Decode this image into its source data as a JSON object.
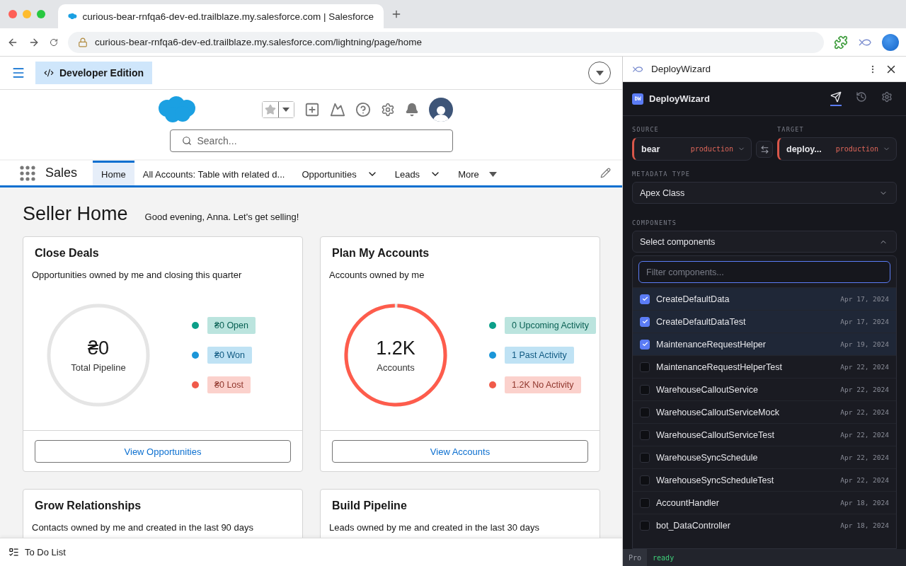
{
  "browser": {
    "tab_title": "curious-bear-rnfqa6-dev-ed.trailblaze.my.salesforce.com | Salesforce",
    "url": "curious-bear-rnfqa6-dev-ed.trailblaze.my.salesforce.com/lightning/page/home"
  },
  "salesforce": {
    "edition": "Developer Edition",
    "search_placeholder": "Search...",
    "app_name": "Sales",
    "nav": [
      {
        "label": "Home",
        "selected": true,
        "kind": "tab"
      },
      {
        "label": "All Accounts: Table with related d...",
        "selected": false,
        "kind": "tab"
      },
      {
        "label": "Opportunities",
        "selected": false,
        "kind": "menu"
      },
      {
        "label": "Leads",
        "selected": false,
        "kind": "menu"
      },
      {
        "label": "More",
        "selected": false,
        "kind": "more"
      }
    ],
    "page_title": "Seller Home",
    "greeting": "Good evening, Anna. Let's get selling!",
    "cards": [
      {
        "title": "Close Deals",
        "subtitle": "Opportunities owned by me and closing this quarter",
        "value": "₴0",
        "value_label": "Total Pipeline",
        "level": 0,
        "legend": [
          {
            "label": "₴0 Open",
            "color": "#0b9f89"
          },
          {
            "label": "₴0 Won",
            "color": "#1b96d8"
          },
          {
            "label": "₴0 Lost",
            "color": "#f05a4a"
          }
        ],
        "button": "View Opportunities"
      },
      {
        "title": "Plan My Accounts",
        "subtitle": "Accounts owned by me",
        "value": "1.2K",
        "value_label": "Accounts",
        "level": 1,
        "legend": [
          {
            "label": "0 Upcoming Activity",
            "color": "#0b9f89"
          },
          {
            "label": "1 Past Activity",
            "color": "#1b96d8"
          },
          {
            "label": "1.2K No Activity",
            "color": "#f05a4a"
          }
        ],
        "button": "View Accounts"
      }
    ],
    "more_cards": [
      {
        "title": "Grow Relationships",
        "subtitle": "Contacts owned by me and created in the last 90 days"
      },
      {
        "title": "Build Pipeline",
        "subtitle": "Leads owned by me and created in the last 30 days"
      }
    ],
    "utility": "To Do List"
  },
  "panel": {
    "header_title": "DeployWizard",
    "badge": "DW",
    "app_title": "DeployWizard",
    "tools": [
      {
        "kind": "deploy",
        "selected": true
      },
      {
        "kind": "history",
        "selected": false
      },
      {
        "kind": "settings",
        "selected": false
      }
    ],
    "source_label": "SOURCE",
    "target_label": "TARGET",
    "source": {
      "org": "bear",
      "env": "production"
    },
    "target": {
      "org": "deploy...",
      "env": "production"
    },
    "metadata_label": "METADATA TYPE",
    "metadata_value": "Apex Class",
    "components_label": "COMPONENTS",
    "components_placeholder": "Select components",
    "expanded": true,
    "filter_placeholder": "Filter components...",
    "items": [
      {
        "name": "CreateDefaultData",
        "date": "Apr 17, 2024",
        "checked": true
      },
      {
        "name": "CreateDefaultDataTest",
        "date": "Apr 17, 2024",
        "checked": true
      },
      {
        "name": "MaintenanceRequestHelper",
        "date": "Apr 19, 2024",
        "checked": true
      },
      {
        "name": "MaintenanceRequestHelperTest",
        "date": "Apr 22, 2024",
        "checked": false
      },
      {
        "name": "WarehouseCalloutService",
        "date": "Apr 22, 2024",
        "checked": false
      },
      {
        "name": "WarehouseCalloutServiceMock",
        "date": "Apr 22, 2024",
        "checked": false
      },
      {
        "name": "WarehouseCalloutServiceTest",
        "date": "Apr 22, 2024",
        "checked": false
      },
      {
        "name": "WarehouseSyncSchedule",
        "date": "Apr 22, 2024",
        "checked": false
      },
      {
        "name": "WarehouseSyncScheduleTest",
        "date": "Apr 22, 2024",
        "checked": false
      },
      {
        "name": "AccountHandler",
        "date": "Apr 18, 2024",
        "checked": false
      },
      {
        "name": "bot_DataController",
        "date": "Apr 18, 2024",
        "checked": false
      }
    ],
    "plan": "Pro",
    "status": "ready"
  }
}
